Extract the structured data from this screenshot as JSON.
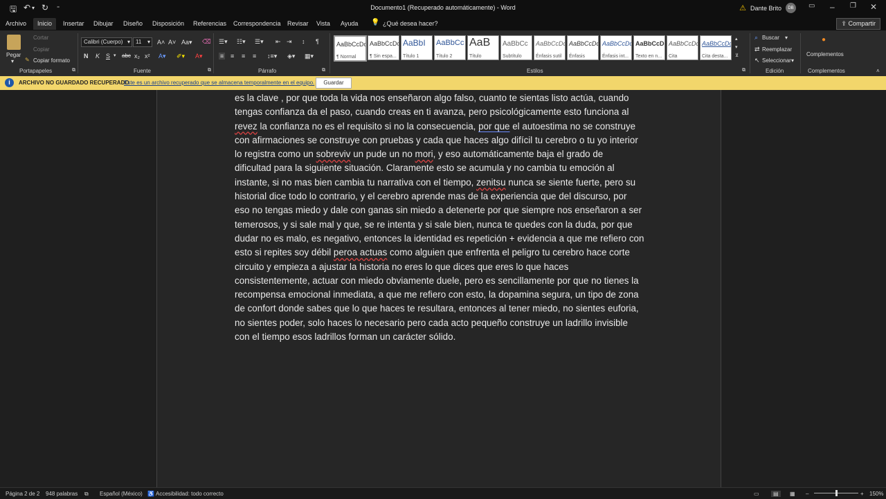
{
  "titlebar": {
    "doc_title": "Documento1 (Recuperado automáticamente)  -  Word",
    "user_name": "Dante Brito",
    "user_initials": "DB"
  },
  "menu": {
    "tabs": [
      "Archivo",
      "Inicio",
      "Insertar",
      "Dibujar",
      "Diseño",
      "Disposición",
      "Referencias",
      "Correspondencia",
      "Revisar",
      "Vista",
      "Ayuda"
    ],
    "search_placeholder": "¿Qué desea hacer?",
    "share_label": "Compartir"
  },
  "ribbon": {
    "clipboard": {
      "paste": "Pegar",
      "cut": "Cortar",
      "copy": "Copiar",
      "format_painter": "Copiar formato",
      "group": "Portapapeles"
    },
    "font": {
      "name": "Calibri (Cuerpo)",
      "size": "11",
      "group": "Fuente"
    },
    "paragraph": {
      "group": "Párrafo"
    },
    "styles": {
      "group": "Estilos",
      "items": [
        {
          "sample": "AaBbCcDc",
          "name": "¶ Normal"
        },
        {
          "sample": "AaBbCcDc",
          "name": "¶ Sin espa..."
        },
        {
          "sample": "AaBbI",
          "name": "Título 1"
        },
        {
          "sample": "AaBbCc",
          "name": "Título 2"
        },
        {
          "sample": "AaB",
          "name": "Título"
        },
        {
          "sample": "AaBbCc",
          "name": "Subtítulo"
        },
        {
          "sample": "AaBbCcDc",
          "name": "Énfasis sutil"
        },
        {
          "sample": "AaBbCcDc",
          "name": "Énfasis"
        },
        {
          "sample": "AaBbCcDc",
          "name": "Énfasis int..."
        },
        {
          "sample": "AaBbCcDc",
          "name": "Texto en n..."
        },
        {
          "sample": "AaBbCcDc",
          "name": "Cita"
        },
        {
          "sample": "AaBbCcDc",
          "name": "Cita desta..."
        }
      ]
    },
    "editing": {
      "find": "Buscar",
      "replace": "Reemplazar",
      "select": "Seleccionar",
      "group": "Edición"
    },
    "addins": {
      "label": "Complementos",
      "group": "Complementos"
    }
  },
  "infobar": {
    "title": "ARCHIVO NO GUARDADO RECUPERADO",
    "message": "Este es un archivo recuperado que se almacena temporalmente en el equipo.",
    "button": "Guardar"
  },
  "document": {
    "lines": [
      "es la clave , por que toda la vida nos enseñaron algo falso, cuanto te sientas listo actúa, cuando",
      "tengas confianza da el paso, cuando creas en ti avanza, pero psicológicamente esto funciona al",
      "revez la confianza no es el requisito si no la consecuencia, por que el autoestima no se construye",
      "con afirmaciones se construye con pruebas y cada que haces algo difícil tu cerebro o tu yo interior",
      "lo registra como un sobreviv un pude un no mori, y eso automáticamente baja el grado de",
      "dificultad para la siguiente situación. Claramente esto se acumula y no cambia tu emoción al",
      "instante, si no mas bien cambia tu narrativa con el tiempo, zenitsu nunca se siente fuerte, pero su",
      "historial dice todo lo contrario, y el cerebro aprende mas de la experiencia que del discurso, por",
      "eso no tengas miedo y dale con ganas sin miedo a detenerte por que siempre nos enseñaron a ser",
      "temerosos, y si sale mal y que, se re intenta y si sale bien, nunca te quedes con la duda, por que",
      "dudar no es malo, es negativo, entonces la identidad es repetición + evidencia a que me refiero con",
      "esto si repites soy débil peroa actuas como alguien que enfrenta el peligro tu cerebro hace corte",
      "circuito  y empieza a ajustar la historia no eres lo que dices que eres lo que haces",
      "consistentemente, actuar con miedo obviamente duele, pero es sencillamente por que no tienes la",
      "recompensa emocional inmediata, a que me refiero con esto, la dopamina segura, un tipo de zona",
      "de confort donde sabes que lo que haces te resultara, entonces al tener miedo, no sientes euforia,",
      "no sientes poder, solo haces lo necesario pero cada acto pequeño construye un ladrillo invisible",
      "con el tiempo esos ladrillos forman un carácter sólido."
    ]
  },
  "status": {
    "page": "Página 2 de 2",
    "words": "948 palabras",
    "language": "Español (México)",
    "accessibility": "Accesibilidad: todo correcto",
    "zoom": "150%"
  }
}
